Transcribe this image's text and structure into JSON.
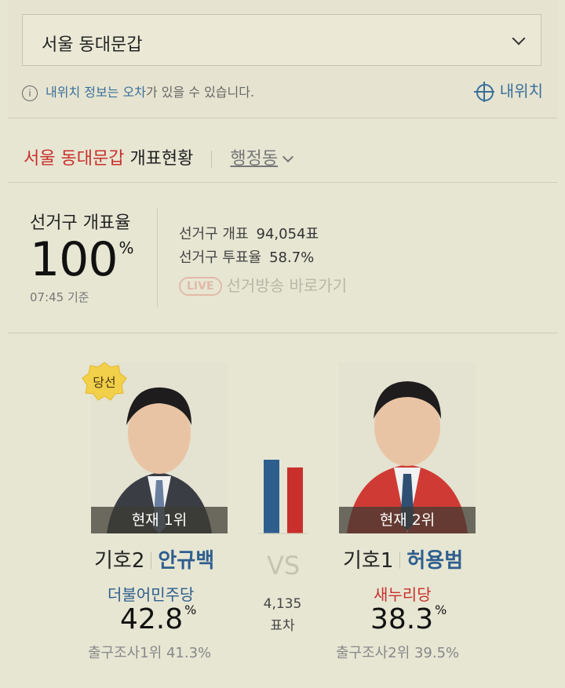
{
  "region_select": {
    "value": "서울 동대문갑"
  },
  "location_notice": {
    "part1": "내위치 정보는 오차",
    "part2": "가 있을 수 있습니다."
  },
  "my_location_label": "내위치",
  "status_header": {
    "region": "서울 동대문갑",
    "title": "개표현황",
    "admin_link": "행정동"
  },
  "count_rate": {
    "label": "선거구 개표율",
    "value": "100",
    "unit": "%",
    "time": "07:45 기준",
    "counted_label": "선거구 개표",
    "counted_value": "94,054표",
    "turnout_label": "선거구 투표율",
    "turnout_value": "58.7%",
    "live_badge": "LIVE",
    "live_link": "선거방송 바로가기"
  },
  "candidates": [
    {
      "winner_badge": "당선",
      "rank": "현재 1위",
      "number": "기호2",
      "name": "안규백",
      "party": "더불어민주당",
      "party_color": "#2e5e8e",
      "vote_pct": "42.8",
      "pct_unit": "%",
      "exit_poll": "출구조사1위 41.3%"
    },
    {
      "rank": "현재 2위",
      "number": "기호1",
      "name": "허용범",
      "party": "새누리당",
      "party_color": "#c9302c",
      "vote_pct": "38.3",
      "pct_unit": "%",
      "exit_poll": "출구조사2위 39.5%"
    }
  ],
  "versus": {
    "label": "VS",
    "gap_value": "4,135",
    "gap_label": "표차"
  },
  "chart_data": {
    "type": "bar",
    "categories": [
      "안규백",
      "허용범"
    ],
    "values": [
      42.8,
      38.3
    ],
    "colors": [
      "#2e5e8e",
      "#c9302c"
    ]
  }
}
